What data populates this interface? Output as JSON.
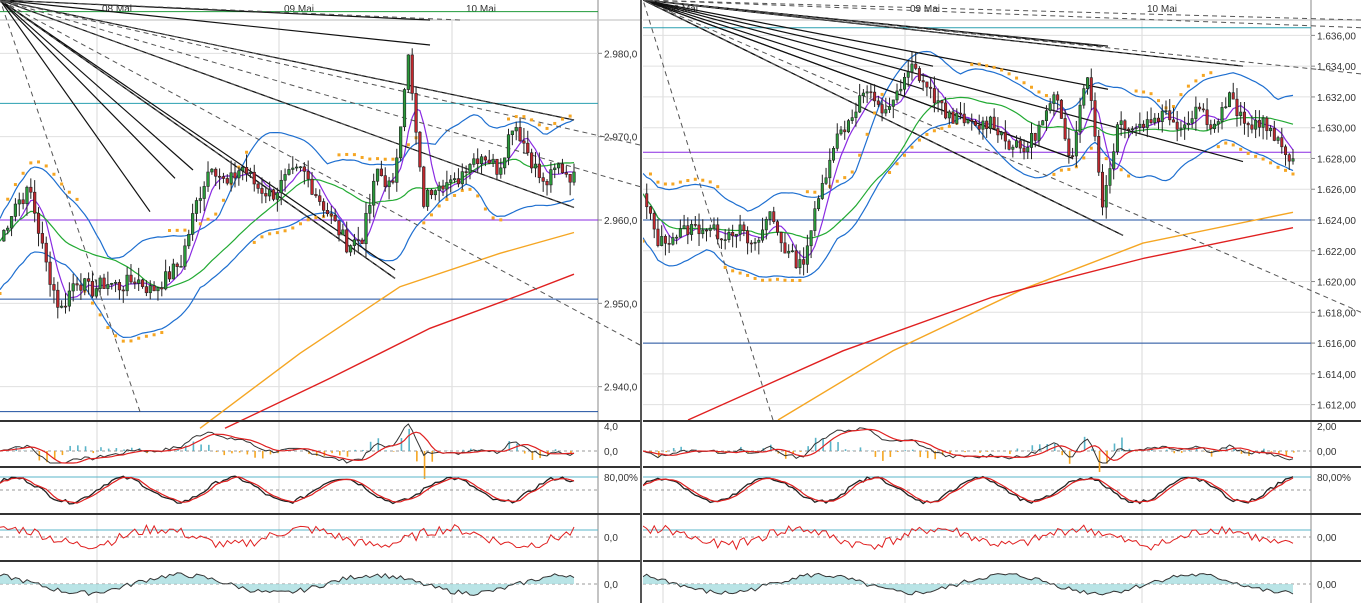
{
  "panels": [
    {
      "id": "left",
      "date_labels": [
        "08 Mai",
        "09 Mai",
        "10 Mai"
      ],
      "price_ticks": [
        "2.980,0",
        "2.970,0",
        "2.960,0",
        "2.950,0",
        "2.940,0"
      ],
      "macd_ticks": [
        "4,0",
        "0,0"
      ],
      "stoch_ticks": [
        "80,00%"
      ],
      "ind3_ticks": [
        "0,0"
      ],
      "ind4_ticks": [
        "0,0"
      ]
    },
    {
      "id": "right",
      "date_labels": [
        "08 Mai",
        "09 Mai",
        "10 Mai"
      ],
      "price_ticks": [
        "1.636,00",
        "1.634,00",
        "1.632,00",
        "1.630,00",
        "1.628,00",
        "1.626,00",
        "1.624,00",
        "1.622,00",
        "1.620,00",
        "1.618,00",
        "1.616,00",
        "1.614,00",
        "1.612,00"
      ],
      "macd_ticks": [
        "2,00",
        "0,00"
      ],
      "stoch_ticks": [
        "80,00%"
      ],
      "ind3_ticks": [
        "0,00"
      ],
      "ind4_ticks": [
        "0,00"
      ]
    }
  ],
  "chart_data": [
    {
      "type": "candlestick",
      "x_labels": [
        "08 Mai",
        "09 Mai",
        "10 Mai"
      ],
      "ylim": [
        2936,
        2984
      ],
      "close_path": [
        2957.5,
        2962.0,
        2963.5,
        2955.0,
        2949.0,
        2953.0,
        2951.5,
        2952.5,
        2952.0,
        2953.0,
        2951.5,
        2953.0,
        2955.0,
        2962.0,
        2967.0,
        2964.0,
        2966.5,
        2964.0,
        2963.0,
        2965.0,
        2966.0,
        2963.0,
        2960.0,
        2957.0,
        2958.0,
        2966.0,
        2963.5,
        2980.0,
        2962.0,
        2965.0,
        2964.0,
        2967.0,
        2968.0,
        2966.0,
        2972.0,
        2968.0,
        2964.0,
        2966.5,
        2965.0
      ],
      "horizontal_levels": [
        2985.0,
        2974.0,
        2960.0,
        2950.5,
        2937.0
      ],
      "grid": true
    },
    {
      "type": "candlestick",
      "x_labels": [
        "08 Mai",
        "09 Mai",
        "10 Mai"
      ],
      "ylim": [
        1611,
        1637
      ],
      "close_path": [
        1625.5,
        1622.5,
        1623.0,
        1623.5,
        1623.5,
        1623.0,
        1623.5,
        1622.0,
        1624.5,
        1622.0,
        1621.0,
        1625.0,
        1629.0,
        1630.5,
        1632.5,
        1631.0,
        1632.0,
        1634.0,
        1632.5,
        1631.0,
        1630.5,
        1630.0,
        1630.5,
        1629.0,
        1628.5,
        1630.0,
        1632.0,
        1628.0,
        1634.0,
        1625.0,
        1630.5,
        1630.0,
        1630.5,
        1631.0,
        1630.0,
        1631.5,
        1630.0,
        1632.0,
        1630.0,
        1630.5,
        1629.0,
        1628.0
      ],
      "horizontal_levels": [
        1636.5,
        1628.4,
        1624.0,
        1616.0
      ],
      "grid": true
    }
  ]
}
